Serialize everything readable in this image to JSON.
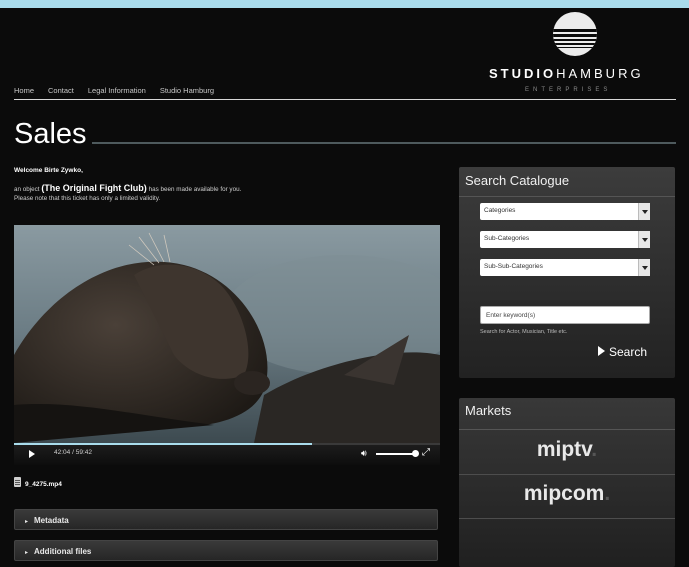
{
  "logo": {
    "brand_bold": "STUDIO",
    "brand_thin": "HAMBURG",
    "sub": "ENTERPRISES"
  },
  "nav": {
    "items": [
      "Home",
      "Contact",
      "Legal Information",
      "Studio Hamburg"
    ]
  },
  "page": {
    "title": "Sales",
    "welcome": "Welcome Birte Zywko,",
    "notice_prefix": "an object",
    "object_name": "(The Original Fight Club)",
    "notice_suffix": "has been made available for you.",
    "notice_line2": "Please note that this ticket has only a limited validity."
  },
  "video": {
    "current_time": "42:04",
    "separator": "/",
    "duration": "59:42",
    "progress": 0.7
  },
  "file": {
    "name": "9_4275.mp4"
  },
  "accordions": {
    "metadata": "Metadata",
    "additional": "Additional files"
  },
  "search": {
    "title": "Search Catalogue",
    "categories": "Categories",
    "sub_categories": "Sub-Categories",
    "sub_sub_categories": "Sub-Sub-Categories",
    "keyword_placeholder": "Enter keyword(s)",
    "hint": "Search for Actor, Musician, Title etc.",
    "button": "Search"
  },
  "markets": {
    "title": "Markets",
    "items": [
      {
        "name": "miptv",
        "dot": "."
      },
      {
        "name": "mipcom",
        "dot": "."
      }
    ]
  },
  "colors": {
    "accent": "#a9dcec",
    "background": "#0b0b0b"
  }
}
